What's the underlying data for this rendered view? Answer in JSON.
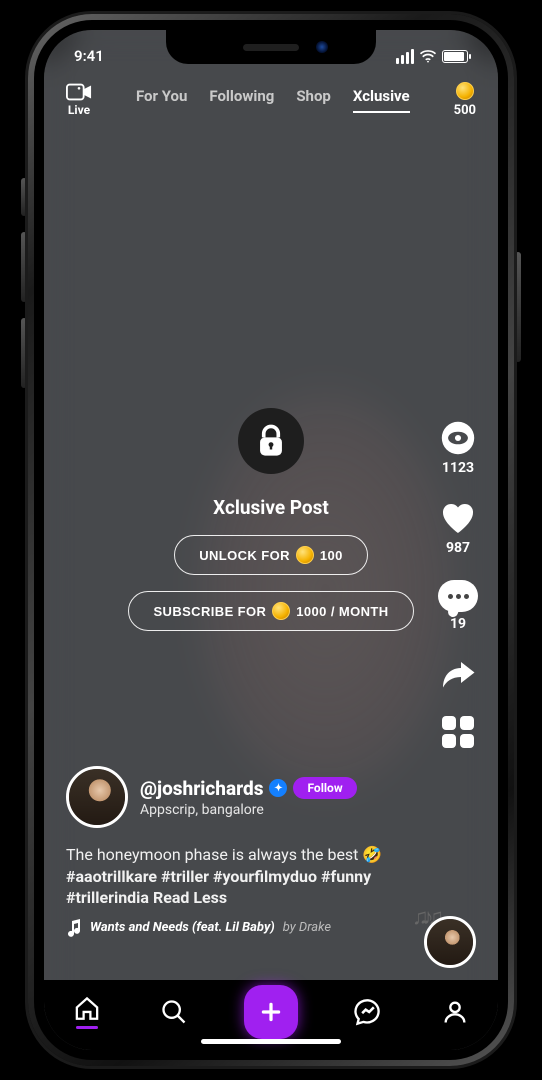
{
  "statusbar": {
    "time": "9:41"
  },
  "topnav": {
    "live_label": "Live",
    "tabs": {
      "for_you": "For You",
      "following": "Following",
      "shop": "Shop",
      "xclusive": "Xclusive"
    },
    "active_tab": "xclusive",
    "balance": "500"
  },
  "locked": {
    "title": "Xclusive Post",
    "unlock_prefix": "UNLOCK FOR",
    "unlock_cost": "100",
    "subscribe_prefix": "SUBSCRIBE FOR",
    "subscribe_cost": "1000 / MONTH"
  },
  "rail": {
    "views": "1123",
    "likes": "987",
    "comments": "19"
  },
  "post": {
    "handle": "@joshrichards",
    "follow_label": "Follow",
    "location": "Appscrip, bangalore",
    "caption_text": "The honeymoon phase is always the best 🤣",
    "caption_tags": "#aaotrillkare #triller #yourfilmyduo #funny #trillerindia",
    "caption_toggle": "Read Less",
    "song_title": "Wants and Needs (feat. Lil Baby)",
    "song_by_prefix": "by",
    "song_artist": "Drake"
  }
}
